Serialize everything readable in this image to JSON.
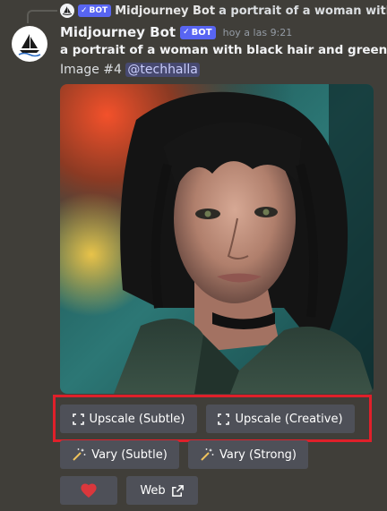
{
  "reply": {
    "bot_tag": "BOT",
    "author": "Midjourney Bot",
    "text": "a portrait of a woman with black hair"
  },
  "message": {
    "author": "Midjourney Bot",
    "bot_tag": "BOT",
    "timestamp": "hoy a las 9:21",
    "prompt": "a portrait of a woman with black hair and green jack",
    "image_label": "Image #4",
    "mention": "@techhalla"
  },
  "buttons": {
    "upscale_subtle": "Upscale (Subtle)",
    "upscale_creative": "Upscale (Creative)",
    "vary_subtle": "Vary (Subtle)",
    "vary_strong": "Vary (Strong)",
    "web": "Web"
  },
  "colors": {
    "background": "#403e39",
    "button": "#4e5058",
    "bot_tag": "#5865f2",
    "highlight": "#e0202a",
    "heart": "#da373c"
  },
  "icons": [
    "sailboat-logo-icon",
    "checkmark-icon",
    "expand-icon",
    "magic-wand-icon",
    "heart-icon",
    "external-link-icon"
  ]
}
